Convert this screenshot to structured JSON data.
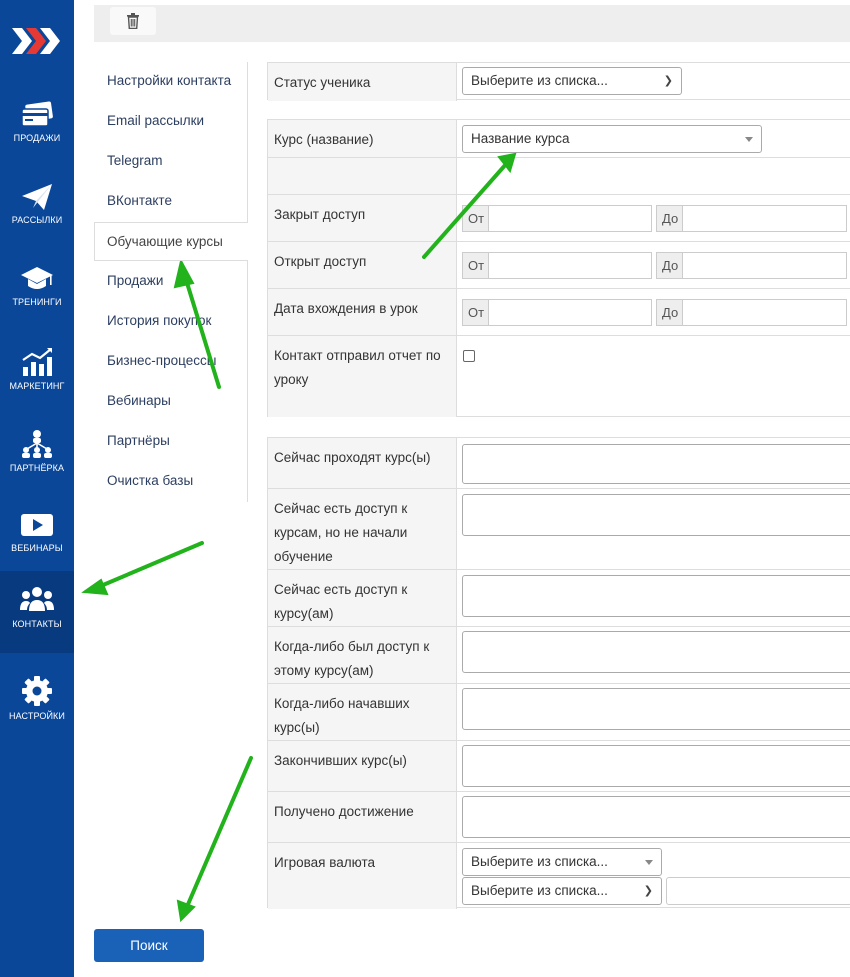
{
  "sidebar": {
    "items": [
      {
        "label": "ПРОДАЖИ",
        "icon": "card-icon"
      },
      {
        "label": "РАССЫЛКИ",
        "icon": "paper-plane-icon"
      },
      {
        "label": "ТРЕНИНГИ",
        "icon": "graduation-cap-icon"
      },
      {
        "label": "МАРКЕТИНГ",
        "icon": "chart-icon"
      },
      {
        "label": "ПАРТНЁРКА",
        "icon": "network-icon"
      },
      {
        "label": "ВЕБИНАРЫ",
        "icon": "play-icon"
      },
      {
        "label": "КОНТАКТЫ",
        "icon": "users-icon"
      },
      {
        "label": "НАСТРОЙКИ",
        "icon": "gear-icon"
      }
    ],
    "active": "КОНТАКТЫ",
    "brand_color": "#0b4799"
  },
  "tabs": {
    "items": [
      "Настройки контакта",
      "Email рассылки",
      "Telegram",
      "ВКонтакте",
      "Обучающие курсы",
      "Продажи",
      "История покупок",
      "Бизнес-процессы",
      "Вебинары",
      "Партнёры",
      "Очистка базы"
    ],
    "active": "Обучающие курсы"
  },
  "form": {
    "student_status": {
      "label": "Статус ученика",
      "value": "Выберите из списка..."
    },
    "course": {
      "label": "Курс (название)",
      "placeholder": "Название курса"
    },
    "access_closed": {
      "label": "Закрыт доступ",
      "from": "От",
      "to": "До"
    },
    "access_open": {
      "label": "Открыт доступ",
      "from": "От",
      "to": "До"
    },
    "lesson_entry_date": {
      "label": "Дата вхождения в урок",
      "from": "От",
      "to": "До"
    },
    "report_sent": {
      "label": "Контакт отправил отчет по уроку",
      "checked": false
    },
    "now_taking": {
      "label": "Сейчас проходят курс(ы)"
    },
    "access_not_started": {
      "label": "Сейчас есть доступ к курсам, но не начали обучение"
    },
    "has_access_now": {
      "label": "Сейчас есть доступ к курсу(ам)"
    },
    "ever_had_access": {
      "label": "Когда-либо был доступ к этому курсу(ам)"
    },
    "ever_started": {
      "label": "Когда-либо начавших курс(ы)"
    },
    "finished": {
      "label": "Закончивших курс(ы)"
    },
    "achievement": {
      "label": "Получено достижение"
    },
    "game_currency": {
      "label": "Игровая валюта",
      "select1": "Выберите из списка...",
      "select2": "Выберите из списка..."
    }
  },
  "search_button": "Поиск",
  "annotation_arrow_color": "#22b21b"
}
